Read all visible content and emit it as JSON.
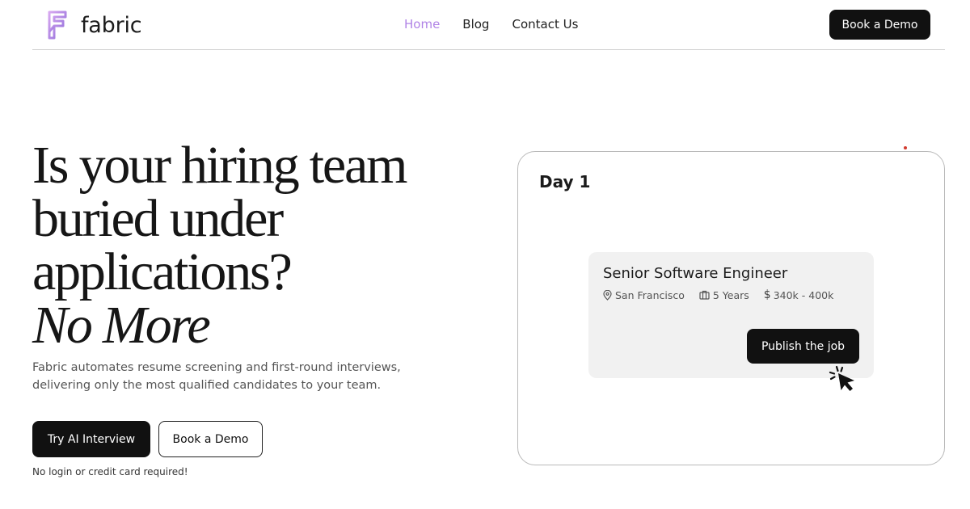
{
  "brand": {
    "name": "fabric",
    "accent": "#b083e6"
  },
  "nav": {
    "items": [
      {
        "label": "Home",
        "active": true
      },
      {
        "label": "Blog",
        "active": false
      },
      {
        "label": "Contact Us",
        "active": false
      }
    ],
    "cta_label": "Book a Demo"
  },
  "hero": {
    "title_lines": [
      "Is your hiring team",
      "buried under",
      "applications?"
    ],
    "title_italic": "No More",
    "subtitle_lines": [
      "Fabric automates resume screening and first-round interviews,",
      "delivering only the most qualified candidates to your team."
    ],
    "primary_button": "Try AI Interview",
    "secondary_button": "Book a Demo",
    "note": "No login or credit card required!"
  },
  "demo_card": {
    "day_label": "Day 1",
    "job": {
      "title": "Senior Software Engineer",
      "location": "San Francisco",
      "experience": "5 Years",
      "salary": "340k - 400k",
      "publish_label": "Publish the job"
    },
    "icons": [
      "location-pin-icon",
      "briefcase-icon",
      "dollar-icon",
      "click-cursor-icon"
    ]
  }
}
